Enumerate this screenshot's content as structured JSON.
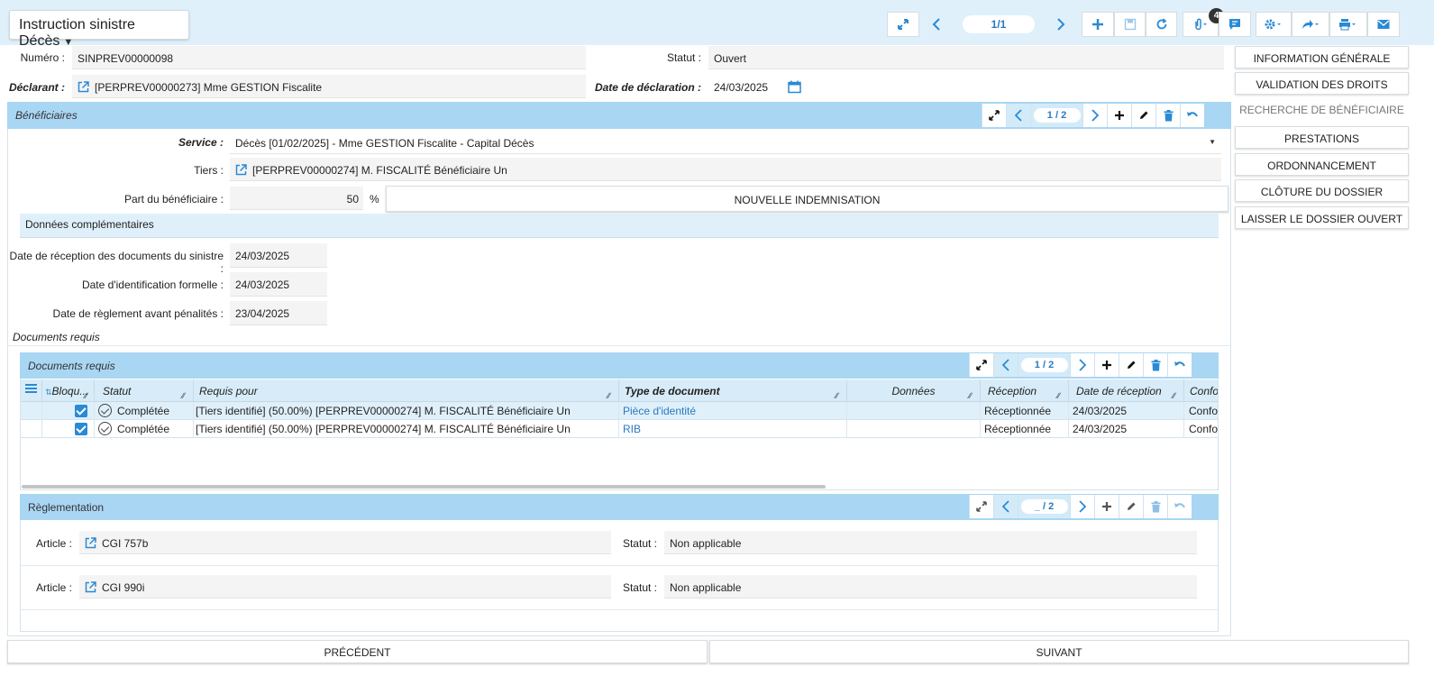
{
  "header": {
    "title": "Instruction sinistre Décès",
    "pager": "1/1",
    "attachment_count": "4"
  },
  "form": {
    "numero_label": "Numéro :",
    "numero_value": "SINPREV00000098",
    "statut_label": "Statut :",
    "statut_value": "Ouvert",
    "declarant_label": "Déclarant :",
    "declarant_value": "[PERPREV00000273] Mme GESTION Fiscalite",
    "date_decl_label": "Date de déclaration :",
    "date_decl_value": "24/03/2025"
  },
  "sidebar": {
    "items": [
      {
        "label": "Information générale"
      },
      {
        "label": "Validation des droits"
      },
      {
        "label": "Recherche de bénéficiaire"
      },
      {
        "label": "Prestations"
      },
      {
        "label": "Ordonnancement"
      },
      {
        "label": "Clôture du dossier"
      },
      {
        "label": "Laisser le dossier ouvert"
      }
    ]
  },
  "beneficiaires": {
    "title": "Bénéficiaires",
    "pager": "1 / 2",
    "service_label": "Service :",
    "service_value": "Décès [01/02/2025] - Mme GESTION Fiscalite - Capital Décès",
    "tiers_label": "Tiers :",
    "tiers_value": "[PERPREV00000274] M. FISCALITÉ Bénéficiaire Un",
    "part_label": "Part du bénéficiaire :",
    "part_value": "50",
    "part_unit": "%",
    "nouvelle_btn": "Nouvelle indemnisation",
    "donnees_title": "Données complémentaires",
    "date_reception_label": "Date de réception des documents du sinistre :",
    "date_reception_value": "24/03/2025",
    "date_ident_label": "Date d'identification formelle :",
    "date_ident_value": "24/03/2025",
    "date_reglement_label": "Date de règlement avant pénalités :",
    "date_reglement_value": "23/04/2025",
    "docs_caption": "Documents requis"
  },
  "documents": {
    "title": "Documents requis",
    "pager": "1 / 2",
    "columns": [
      "Bloqu...",
      "Statut",
      "Requis pour",
      "Type de document",
      "Données",
      "Réception",
      "Date de réception",
      "Confo"
    ],
    "rows": [
      {
        "statut": "Complétée",
        "requis": "[Tiers identifié] (50.00%) [PERPREV00000274] M. FISCALITÉ Bénéficiaire Un",
        "type": "Pièce d'identité",
        "donnees": "",
        "reception": "Réceptionnée",
        "date": "24/03/2025",
        "confo": "Confor"
      },
      {
        "statut": "Complétée",
        "requis": "[Tiers identifié] (50.00%) [PERPREV00000274] M. FISCALITÉ Bénéficiaire Un",
        "type": "RIB",
        "donnees": "",
        "reception": "Réceptionnée",
        "date": "24/03/2025",
        "confo": "Confor"
      }
    ]
  },
  "reglementation": {
    "title": "Règlementation",
    "pager": "_ / 2",
    "article_label": "Article :",
    "statut_label": "Statut :",
    "items": [
      {
        "article": "CGI 757b",
        "statut": "Non applicable"
      },
      {
        "article": "CGI 990i",
        "statut": "Non applicable"
      }
    ]
  },
  "footer": {
    "prev": "Précédent",
    "next": "Suivant"
  },
  "colors": {
    "accent": "#2a8ad4",
    "panel": "#a9d6f3",
    "topbar": "#dff0fa"
  }
}
